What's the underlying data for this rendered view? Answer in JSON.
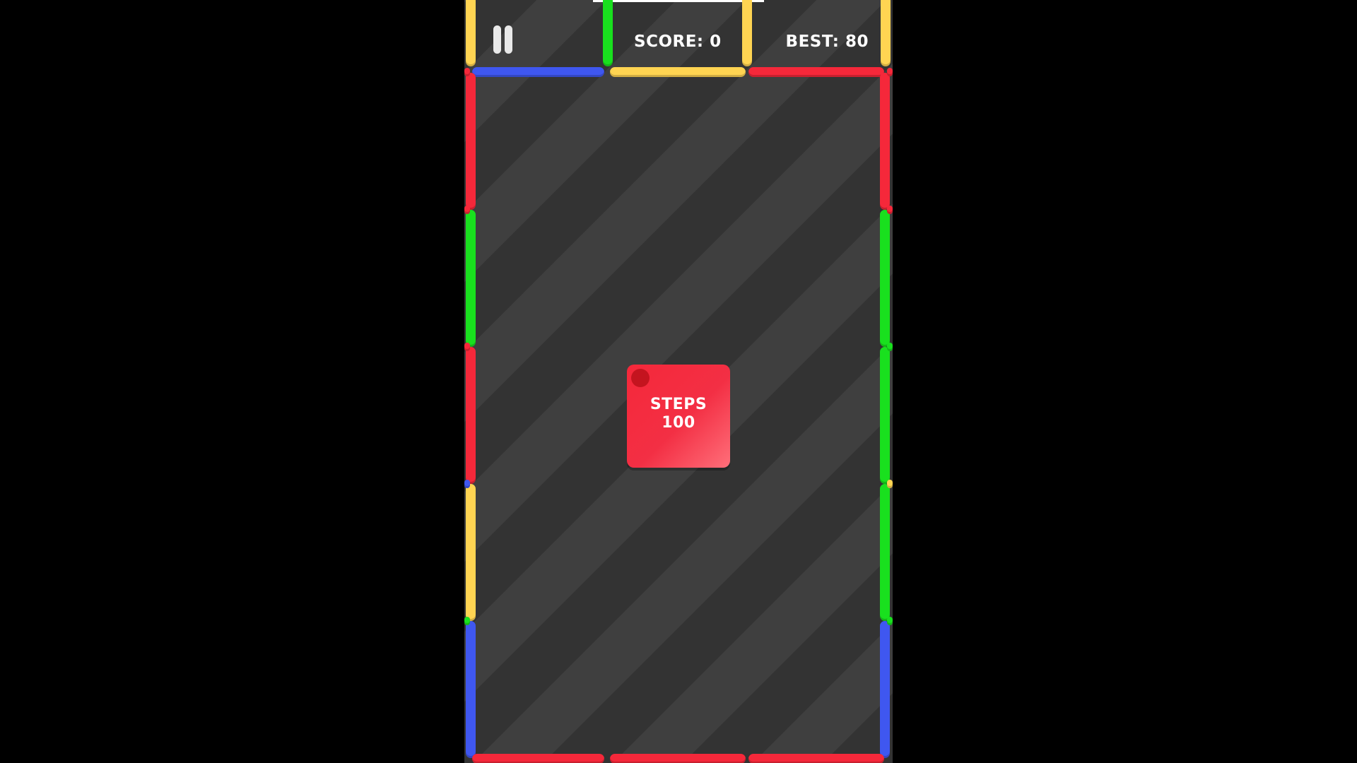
{
  "hud": {
    "score_label": "SCORE: 0",
    "best_label": "BEST: 80",
    "pause_icon": "pause-icon"
  },
  "center_block": {
    "title": "STEPS",
    "value": "100",
    "color": "#f5283a"
  },
  "palette": {
    "red": "#f5283a",
    "green": "#19e01e",
    "blue": "#3f57f0",
    "yellow": "#ffd452",
    "background_dark": "#333333",
    "background_light": "#3f3f3f"
  }
}
